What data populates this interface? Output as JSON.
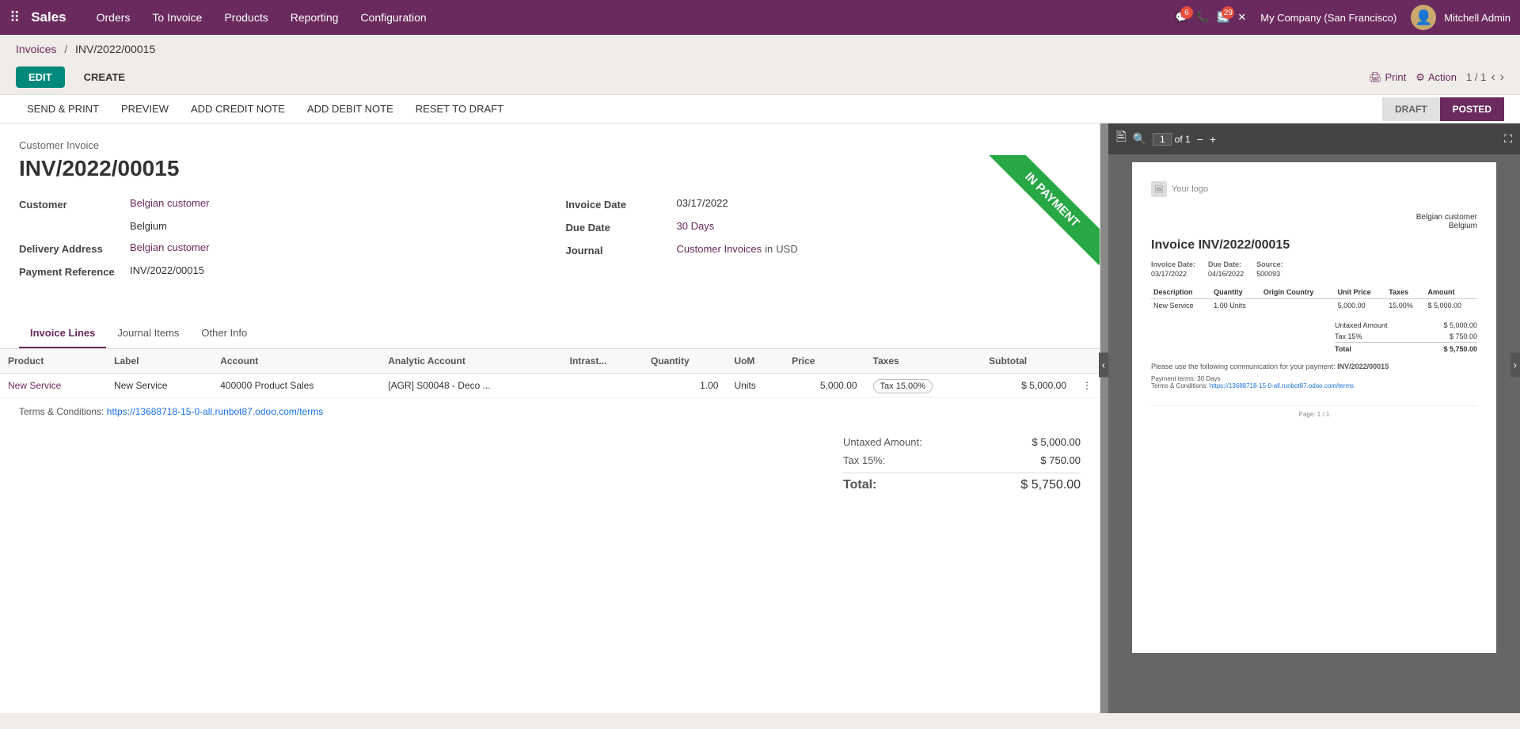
{
  "app": {
    "name": "Sales",
    "nav_items": [
      "Orders",
      "To Invoice",
      "Products",
      "Reporting",
      "Configuration"
    ],
    "right_icons": {
      "chat_count": "6",
      "phone_icon": "📞",
      "clock_count": "29",
      "settings_icon": "✕"
    },
    "company": "My Company (San Francisco)",
    "user": "Mitchell Admin"
  },
  "breadcrumb": {
    "parent": "Invoices",
    "separator": "/",
    "current": "INV/2022/00015"
  },
  "toolbar": {
    "edit_label": "EDIT",
    "create_label": "CREATE",
    "print_label": "Print",
    "action_label": "Action",
    "page_current": "1",
    "page_total": "1"
  },
  "secondary_toolbar": {
    "send_print_label": "SEND & PRINT",
    "preview_label": "PREVIEW",
    "add_credit_note_label": "ADD CREDIT NOTE",
    "add_debit_note_label": "ADD DEBIT NOTE",
    "reset_to_draft_label": "RESET TO DRAFT",
    "status_draft": "DRAFT",
    "status_posted": "POSTED"
  },
  "invoice": {
    "type": "Customer Invoice",
    "number": "INV/2022/00015",
    "in_payment_label": "IN PAYMENT",
    "customer_label": "Customer",
    "customer_value": "Belgian customer",
    "address": "Belgium",
    "delivery_address_label": "Delivery Address",
    "delivery_address_value": "Belgian customer",
    "payment_reference_label": "Payment Reference",
    "payment_reference_value": "INV/2022/00015",
    "invoice_date_label": "Invoice Date",
    "invoice_date_value": "03/17/2022",
    "due_date_label": "Due Date",
    "due_date_value": "30 Days",
    "journal_label": "Journal",
    "journal_value": "Customer Invoices",
    "journal_currency": "in",
    "journal_currency_code": "USD"
  },
  "tabs": {
    "invoice_lines": "Invoice Lines",
    "journal_items": "Journal Items",
    "other_info": "Other Info"
  },
  "table": {
    "columns": [
      "Product",
      "Label",
      "Account",
      "Analytic Account",
      "Intrast...",
      "Quantity",
      "UoM",
      "Price",
      "Taxes",
      "Subtotal"
    ],
    "rows": [
      {
        "product": "New Service",
        "label": "New Service",
        "account": "400000 Product Sales",
        "analytic_account": "[AGR] S00048 - Deco ...",
        "intrastat": "",
        "quantity": "1.00",
        "uom": "Units",
        "price": "5,000.00",
        "taxes": "Tax 15.00%",
        "subtotal": "$ 5,000.00"
      }
    ]
  },
  "terms": {
    "label": "Terms & Conditions:",
    "link": "https://13688718-15-0-all.runbot87.odoo.com/terms"
  },
  "totals": {
    "untaxed_label": "Untaxed Amount:",
    "untaxed_value": "$ 5,000.00",
    "tax_label": "Tax 15%:",
    "tax_value": "$ 750.00",
    "total_label": "Total:",
    "total_value": "$ 5,750.00"
  },
  "preview": {
    "toolbar": {
      "page_indicator": "1 of 1",
      "zoom_in": "+",
      "zoom_out": "−",
      "fullscreen": "⛶"
    },
    "pdf": {
      "logo_text": "Your logo",
      "customer_name": "Belgian customer",
      "customer_country": "Belgium",
      "invoice_title": "Invoice INV/2022/00015",
      "invoice_date_label": "Invoice Date:",
      "invoice_date_value": "03/17/2022",
      "due_date_label": "Due Date:",
      "due_date_value": "04/16/2022",
      "source_label": "Source:",
      "source_value": "500093",
      "table_headers": [
        "Description",
        "Quantity",
        "Origin Country",
        "Unit Price",
        "Taxes",
        "Amount"
      ],
      "table_rows": [
        [
          "New Service",
          "1.00 Units",
          "",
          "5,000.00",
          "15.00%",
          "$ 5,000.00"
        ]
      ],
      "untaxed_label": "Untaxed Amount",
      "untaxed_value": "$ 5,000.00",
      "tax_label": "Tax 15%",
      "tax_value": "$ 750.00",
      "total_label": "Total",
      "total_value": "$ 5,750.00",
      "payment_terms": "Payment terms: 30 Days",
      "communication_label": "Please use the following communication for your payment:",
      "communication_value": "INV/2022/00015",
      "tc_label": "Terms & Conditions:",
      "tc_link": "https://13688718-15-0-all.runbot87.odoo.com/terms",
      "page_num": "Page: 1 / 1"
    }
  }
}
